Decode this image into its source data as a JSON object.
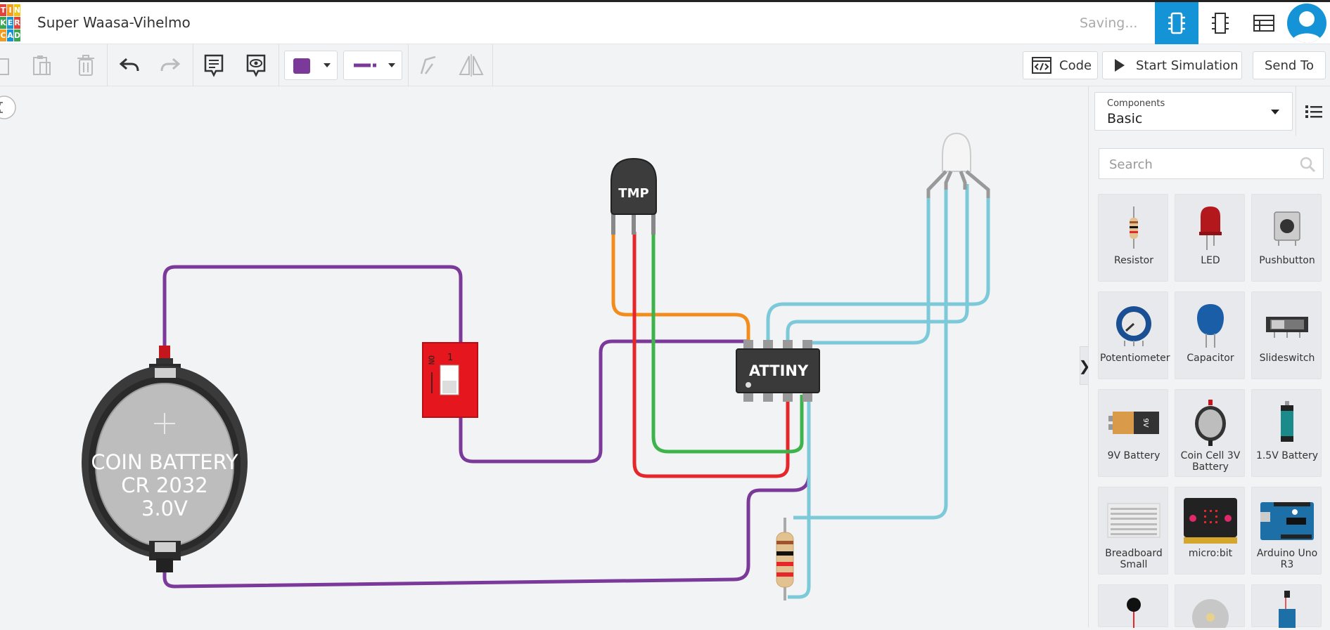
{
  "app": {
    "logo_letters": [
      "T",
      "I",
      "N",
      "K",
      "E",
      "R",
      "C",
      "A",
      "D"
    ],
    "logo_colors": [
      "#e2443a",
      "#f49c1e",
      "#f1c315",
      "#3ba651",
      "#1493d6",
      "#e2443a",
      "#f49c1e",
      "#1493d6",
      "#3ba651"
    ],
    "title": "Super Waasa-Vihelmo",
    "status": "Saving...",
    "accent": "#1493d6"
  },
  "top_views": [
    "circuit-view-icon",
    "schematic-view-icon",
    "component-list-icon"
  ],
  "toolbar": {
    "tools": [
      "copy-icon",
      "paste-icon",
      "delete-icon",
      "undo-icon",
      "redo-icon",
      "notes-icon",
      "view-notes-icon"
    ],
    "wire_color": "#7b3a99",
    "code_label": "Code",
    "sim_label": "Start Simulation",
    "send_label": "Send To"
  },
  "canvas": {
    "battery_lines": [
      "COIN BATTERY",
      "CR 2032",
      "3.0V"
    ],
    "chip_label": "ATTINY",
    "sensor_label": "TMP",
    "switch_on": "ON",
    "switch_num": "1",
    "wire_colors": {
      "purple": "#7b3a99",
      "orange": "#f28c1d",
      "red": "#e5262b",
      "green": "#3cb44b",
      "cyan": "#7cc9d9"
    }
  },
  "panel": {
    "components_label": "Components",
    "components_value": "Basic",
    "search_placeholder": "Search",
    "collapse_glyph": "❯",
    "items": [
      {
        "name": "Resistor"
      },
      {
        "name": "LED"
      },
      {
        "name": "Pushbutton"
      },
      {
        "name": "Potentiometer"
      },
      {
        "name": "Capacitor"
      },
      {
        "name": "Slideswitch"
      },
      {
        "name": "9V Battery"
      },
      {
        "name": "Coin Cell 3V Battery"
      },
      {
        "name": "1.5V Battery"
      },
      {
        "name": "Breadboard Small"
      },
      {
        "name": "micro:bit"
      },
      {
        "name": "Arduino Uno R3"
      }
    ]
  }
}
